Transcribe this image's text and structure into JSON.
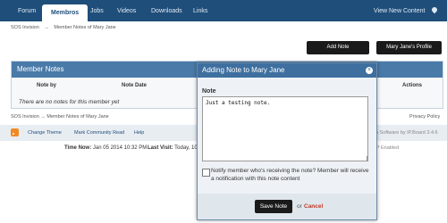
{
  "nav": {
    "tabs": [
      "Forum",
      "Membros",
      "Jobs",
      "Videos",
      "Downloads",
      "Links"
    ],
    "active_tab": "Membros",
    "view_new_content": "View New Content",
    "icons": {
      "pin": "map-pin-icon"
    }
  },
  "breadcrumb": {
    "home": "SOS Invision",
    "separator": "→",
    "current": "Member Notes of Mary Jane"
  },
  "actions": {
    "add_note": "Add Note",
    "profile": "Mary Jane's Profile"
  },
  "notes_panel": {
    "title": "Member Notes",
    "columns": {
      "note_by": "Note by",
      "note_date": "Note Date",
      "actions": "Actions"
    },
    "empty_message": "There are no notes for this member yet"
  },
  "footer": {
    "crumb_home": "SOS Invision",
    "crumb_separator": "→",
    "crumb_current": "Member Notes of Mary Jane",
    "privacy": "Privacy Policy",
    "links": {
      "change_theme": "Change Theme",
      "mark_read": "Mark Community Read",
      "help": "Help"
    },
    "powered_by": "n Software by IP.Board 3.4.6",
    "time_label": "Time Now:",
    "time_value": "Jan 05 2014 10:32 PM",
    "last_visit_label": "Last Visit:",
    "last_visit_value": "Today, 10",
    "gzip": "ZIP Enabled"
  },
  "modal": {
    "title": "Adding Note to Mary Jane",
    "note_label": "Note",
    "note_value": "Just a testing note.",
    "notify_text": "Notify member who's receiving the note? Member will receive a notification with this note content",
    "notify_checked": false,
    "save_label": "Save Note",
    "or_text": "or",
    "cancel_label": "Cancel",
    "close_glyph": "×"
  },
  "colors": {
    "nav": "#1f4e7a",
    "panel_header": "#4a7aa8",
    "modal_header": "#3e6f9f",
    "cancel": "#c0392b"
  }
}
